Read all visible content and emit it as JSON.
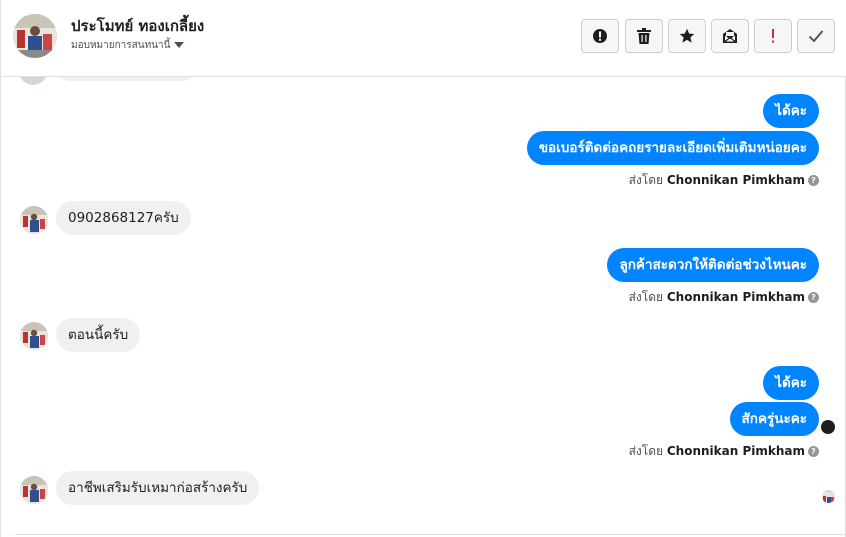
{
  "header": {
    "contact_name": "ประโมทย์ ทองเกลี้ยง",
    "assign_label": "มอบหมายการสนทนานี้"
  },
  "toolbar": {
    "buttons": [
      {
        "name": "mark-spam-button",
        "icon": "exclamation-circle-icon"
      },
      {
        "name": "delete-button",
        "icon": "trash-icon"
      },
      {
        "name": "star-button",
        "icon": "star-icon"
      },
      {
        "name": "mark-unread-button",
        "icon": "envelope-icon"
      },
      {
        "name": "follow-up-button",
        "icon": "red-exclamation-icon"
      },
      {
        "name": "mark-done-button",
        "icon": "check-icon"
      }
    ],
    "accent_red": "#e41e3f"
  },
  "messages": {
    "out1": "ได้คะ",
    "out2": "ขอเบอร์ติดต่อคถยรายละเอียดเพิ่มเติมหน่อยคะ",
    "in1": "0902868127ครับ",
    "out3": "ลูกค้าสะดวกให้ติดต่อช่วงไหนคะ",
    "in2": "ตอนนี้ครับ",
    "out4": "ได้คะ",
    "out5": "สักครู่นะคะ",
    "in3": "อาชีพเสริมรับเหมาก่อสร้างครับ"
  },
  "sent_by": {
    "prefix": "ส่งโดย",
    "name": "Chonnikan Pimkham",
    "help_glyph": "?"
  },
  "colors": {
    "outgoing_bubble": "#0084ff",
    "incoming_bubble": "#f1f0f0"
  }
}
